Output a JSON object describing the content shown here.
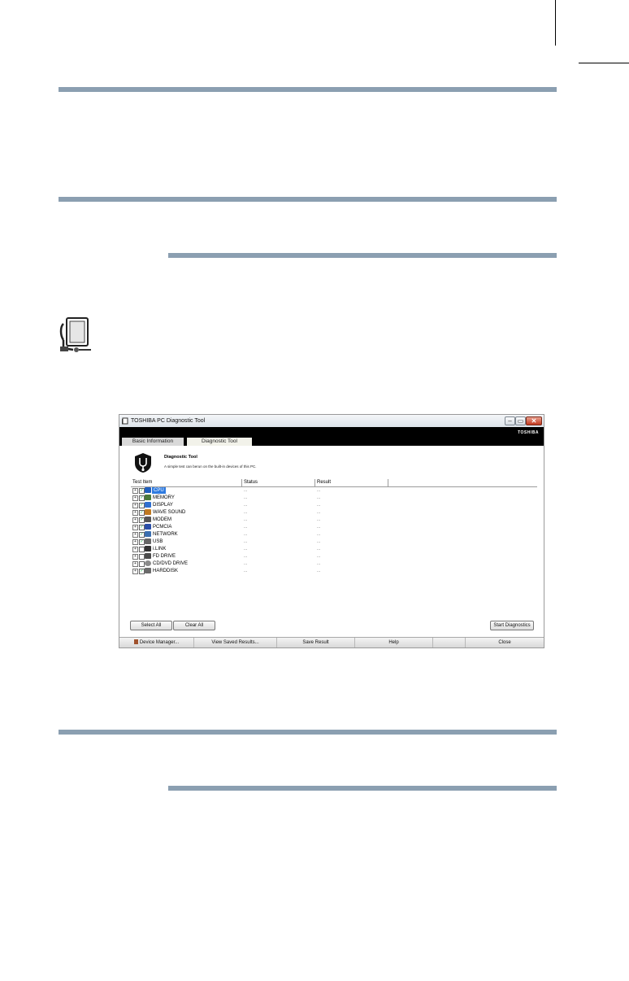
{
  "window": {
    "title": "TOSHIBA PC Diagnostic Tool",
    "brand": "TOSHIBA",
    "min_glyph": "–",
    "max_glyph": "▭",
    "close_glyph": "✕"
  },
  "tabs": [
    "Basic Information",
    "Diagnostic Tool"
  ],
  "header": {
    "title": "Diagnostic Tool",
    "description": "A simple test can berun on the built-in devices of this PC."
  },
  "columns": [
    "Test Item",
    "Status",
    "Result"
  ],
  "items": [
    {
      "label": "CPU",
      "checked": true,
      "selected": true,
      "icon": "cpu-icon"
    },
    {
      "label": "MEMORY",
      "checked": true,
      "selected": false,
      "icon": "memory-icon"
    },
    {
      "label": "DISPLAY",
      "checked": true,
      "selected": false,
      "icon": "display-icon"
    },
    {
      "label": "WAVE SOUND",
      "checked": true,
      "selected": false,
      "icon": "sound-icon"
    },
    {
      "label": "MODEM",
      "checked": true,
      "selected": false,
      "icon": "modem-icon"
    },
    {
      "label": "PCMCIA",
      "checked": true,
      "selected": false,
      "icon": "pcmcia-icon"
    },
    {
      "label": "NETWORK",
      "checked": true,
      "selected": false,
      "icon": "network-icon"
    },
    {
      "label": "USB",
      "checked": true,
      "selected": false,
      "icon": "usb-icon"
    },
    {
      "label": "i.LINK",
      "checked": false,
      "selected": false,
      "icon": "ilink-icon"
    },
    {
      "label": "FD DRIVE",
      "checked": false,
      "selected": false,
      "icon": "floppy-icon"
    },
    {
      "label": "CD/DVD DRIVE",
      "checked": false,
      "selected": false,
      "icon": "cd-icon"
    },
    {
      "label": "HARDDISK",
      "checked": true,
      "selected": false,
      "icon": "harddisk-icon"
    }
  ],
  "status_placeholder": "...",
  "result_placeholder": "...",
  "expand_glyph": "+",
  "check_glyph": "✓",
  "buttons": {
    "select_all": "Select All",
    "clear_all": "Clear All",
    "start": "Start Diagnostics"
  },
  "bottom_bar": [
    "Device Manager...",
    "View Saved Results...",
    "Save Result",
    "Help",
    "Close"
  ],
  "colors": {
    "rule": "#8b9fb1",
    "selection": "#2f7be0"
  }
}
